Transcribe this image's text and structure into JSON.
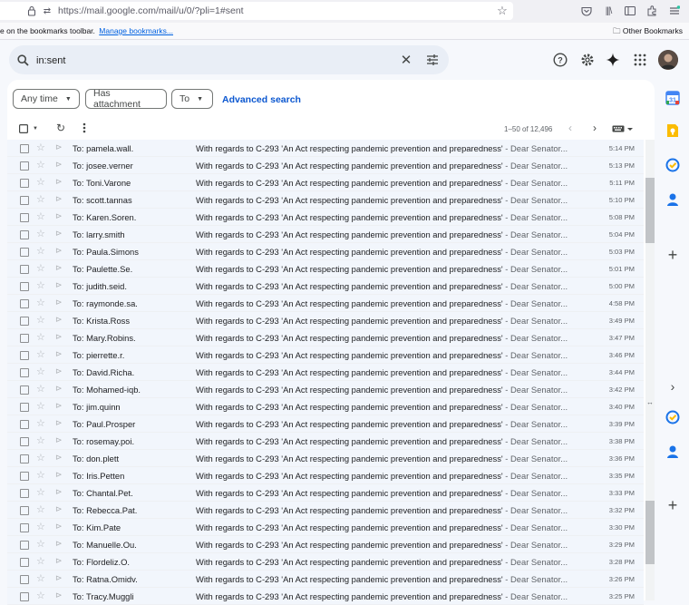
{
  "browser": {
    "url": "https://mail.google.com/mail/u/0/?pli=1#sent",
    "bookmarks_prefix": "e on the bookmarks toolbar.",
    "bookmarks_link": "Manage bookmarks...",
    "other_bookmarks": "Other Bookmarks"
  },
  "search": {
    "value": "in:sent"
  },
  "filters": {
    "any_time": "Any time",
    "has_attachment": "Has attachment",
    "to": "To",
    "advanced": "Advanced search"
  },
  "pager": {
    "text": "1–50 of 12,496"
  },
  "colors": {
    "accent": "#0b57d0",
    "row_bg": "#f2f6fc"
  },
  "emails": [
    {
      "to": "To: pamela.wall.",
      "subject": "With regards to C-293 'An Act respecting pandemic prevention and preparedness'",
      "snippet": " - Dear Senator...",
      "time": "5:14 PM"
    },
    {
      "to": "To: josee.verner",
      "subject": "With regards to C-293 'An Act respecting pandemic prevention and preparedness'",
      "snippet": " - Dear Senator...",
      "time": "5:13 PM"
    },
    {
      "to": "To: Toni.Varone",
      "subject": "With regards to C-293 'An Act respecting pandemic prevention and preparedness'",
      "snippet": " - Dear Senator...",
      "time": "5:11 PM"
    },
    {
      "to": "To: scott.tannas",
      "subject": "With regards to C-293 'An Act respecting pandemic prevention and preparedness'",
      "snippet": " - Dear Senator...",
      "time": "5:10 PM"
    },
    {
      "to": "To: Karen.Soren.",
      "subject": "With regards to C-293 'An Act respecting pandemic prevention and preparedness'",
      "snippet": " - Dear Senator...",
      "time": "5:08 PM"
    },
    {
      "to": "To: larry.smith",
      "subject": "With regards to C-293 'An Act respecting pandemic prevention and preparedness'",
      "snippet": " - Dear Senator...",
      "time": "5:04 PM"
    },
    {
      "to": "To: Paula.Simons",
      "subject": "With regards to C-293 'An Act respecting pandemic prevention and preparedness'",
      "snippet": " - Dear Senator...",
      "time": "5:03 PM"
    },
    {
      "to": "To: Paulette.Se.",
      "subject": "With regards to C-293 'An Act respecting pandemic prevention and preparedness'",
      "snippet": " - Dear Senator...",
      "time": "5:01 PM"
    },
    {
      "to": "To: judith.seid.",
      "subject": "With regards to C-293 'An Act respecting pandemic prevention and preparedness'",
      "snippet": " - Dear Senator...",
      "time": "5:00 PM"
    },
    {
      "to": "To: raymonde.sa.",
      "subject": "With regards to C-293 'An Act respecting pandemic prevention and preparedness'",
      "snippet": " - Dear Senator...",
      "time": "4:58 PM"
    },
    {
      "to": "To: Krista.Ross",
      "subject": "With regards to C-293 'An Act respecting pandemic prevention and preparedness'",
      "snippet": " - Dear Senator...",
      "time": "3:49 PM"
    },
    {
      "to": "To: Mary.Robins.",
      "subject": "With regards to C-293 'An Act respecting pandemic prevention and preparedness'",
      "snippet": " - Dear Senator...",
      "time": "3:47 PM"
    },
    {
      "to": "To: pierrette.r.",
      "subject": "With regards to C-293 'An Act respecting pandemic prevention and preparedness'",
      "snippet": " - Dear Senator...",
      "time": "3:46 PM"
    },
    {
      "to": "To: David.Richa.",
      "subject": "With regards to C-293 'An Act respecting pandemic prevention and preparedness'",
      "snippet": " - Dear Senator...",
      "time": "3:44 PM"
    },
    {
      "to": "To: Mohamed-iqb.",
      "subject": "With regards to C-293 'An Act respecting pandemic prevention and preparedness'",
      "snippet": " - Dear Senator...",
      "time": "3:42 PM"
    },
    {
      "to": "To: jim.quinn",
      "subject": "With regards to C-293 'An Act respecting pandemic prevention and preparedness'",
      "snippet": " - Dear Senator...",
      "time": "3:40 PM"
    },
    {
      "to": "To: Paul.Prosper",
      "subject": "With regards to C-293 'An Act respecting pandemic prevention and preparedness'",
      "snippet": " - Dear Senator...",
      "time": "3:39 PM"
    },
    {
      "to": "To: rosemay.poi.",
      "subject": "With regards to C-293 'An Act respecting pandemic prevention and preparedness'",
      "snippet": " - Dear Senator...",
      "time": "3:38 PM"
    },
    {
      "to": "To: don.plett",
      "subject": "With regards to C-293 'An Act respecting pandemic prevention and preparedness'",
      "snippet": " - Dear Senator...",
      "time": "3:36 PM"
    },
    {
      "to": "To: Iris.Petten",
      "subject": "With regards to C-293 'An Act respecting pandemic prevention and preparedness'",
      "snippet": " - Dear Senator...",
      "time": "3:35 PM"
    },
    {
      "to": "To: Chantal.Pet.",
      "subject": "With regards to C-293 'An Act respecting pandemic prevention and preparedness'",
      "snippet": " - Dear Senator...",
      "time": "3:33 PM"
    },
    {
      "to": "To: Rebecca.Pat.",
      "subject": "With regards to C-293 'An Act respecting pandemic prevention and preparedness'",
      "snippet": " - Dear Senator...",
      "time": "3:32 PM"
    },
    {
      "to": "To: Kim.Pate",
      "subject": "With regards to C-293 'An Act respecting pandemic prevention and preparedness'",
      "snippet": " - Dear Senator...",
      "time": "3:30 PM"
    },
    {
      "to": "To: Manuelle.Ou.",
      "subject": "With regards to C-293 'An Act respecting pandemic prevention and preparedness'",
      "snippet": " - Dear Senator...",
      "time": "3:29 PM"
    },
    {
      "to": "To: Flordeliz.O.",
      "subject": "With regards to C-293 'An Act respecting pandemic prevention and preparedness'",
      "snippet": " - Dear Senator...",
      "time": "3:28 PM"
    },
    {
      "to": "To: Ratna.Omidv.",
      "subject": "With regards to C-293 'An Act respecting pandemic prevention and preparedness'",
      "snippet": " - Dear Senator...",
      "time": "3:26 PM"
    },
    {
      "to": "To: Tracy.Muggli",
      "subject": "With regards to C-293 'An Act respecting pandemic prevention and preparedness'",
      "snippet": " - Dear Senator...",
      "time": "3:25 PM"
    }
  ]
}
